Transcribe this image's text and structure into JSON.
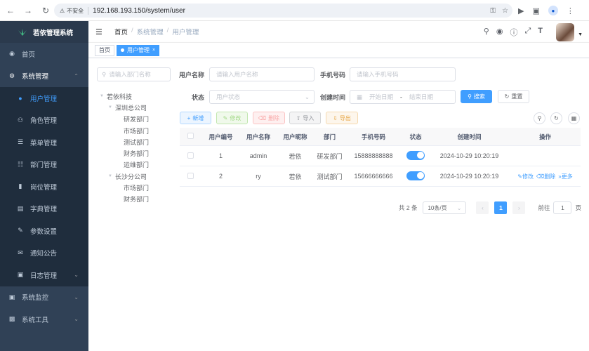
{
  "browser": {
    "security_label": "不安全",
    "url": "192.168.193.150/system/user"
  },
  "sidebar": {
    "logo_text": "若依管理系统",
    "items": [
      {
        "label": "首页",
        "icon": "dashboard-icon"
      },
      {
        "label": "系统管理",
        "icon": "gear-icon",
        "expanded": true
      },
      {
        "label": "系统监控",
        "icon": "monitor-icon"
      },
      {
        "label": "系统工具",
        "icon": "tool-icon"
      }
    ],
    "sub_items": [
      {
        "label": "用户管理",
        "active": true
      },
      {
        "label": "角色管理"
      },
      {
        "label": "菜单管理"
      },
      {
        "label": "部门管理"
      },
      {
        "label": "岗位管理"
      },
      {
        "label": "字典管理"
      },
      {
        "label": "参数设置"
      },
      {
        "label": "通知公告"
      },
      {
        "label": "日志管理"
      }
    ],
    "active_color": "#409eff",
    "background": "#304156"
  },
  "breadcrumb": [
    "首页",
    "系统管理",
    "用户管理"
  ],
  "tags": [
    {
      "label": "首页"
    },
    {
      "label": "用户管理",
      "active": true
    }
  ],
  "dept_search": {
    "placeholder": "请输入部门名称"
  },
  "dept_tree": [
    {
      "label": "若依科技",
      "level": 0,
      "caret": true
    },
    {
      "label": "深圳总公司",
      "level": 1,
      "caret": true
    },
    {
      "label": "研发部门",
      "level": 2
    },
    {
      "label": "市场部门",
      "level": 2
    },
    {
      "label": "测试部门",
      "level": 2
    },
    {
      "label": "财务部门",
      "level": 2
    },
    {
      "label": "运维部门",
      "level": 2
    },
    {
      "label": "长沙分公司",
      "level": 1,
      "caret": true
    },
    {
      "label": "市场部门",
      "level": 2
    },
    {
      "label": "财务部门",
      "level": 2
    }
  ],
  "search_form": {
    "username_label": "用户名称",
    "username_placeholder": "请输入用户名称",
    "phone_label": "手机号码",
    "phone_placeholder": "请输入手机号码",
    "status_label": "状态",
    "status_placeholder": "用户状态",
    "created_label": "创建时间",
    "start_placeholder": "开始日期",
    "range_sep": "-",
    "end_placeholder": "结束日期",
    "search_btn": "搜索",
    "reset_btn": "重置"
  },
  "toolbar": {
    "add": "新增",
    "edit": "修改",
    "delete": "删除",
    "import": "导入",
    "export": "导出"
  },
  "table": {
    "columns": [
      "用户编号",
      "用户名称",
      "用户昵称",
      "部门",
      "手机号码",
      "状态",
      "创建时间",
      "操作"
    ],
    "rows": [
      {
        "id": "1",
        "username": "admin",
        "nickname": "若依",
        "dept": "研发部门",
        "phone": "15888888888",
        "status_on": true,
        "created": "2024-10-29 10:20:19",
        "ops": []
      },
      {
        "id": "2",
        "username": "ry",
        "nickname": "若依",
        "dept": "测试部门",
        "phone": "15666666666",
        "status_on": true,
        "created": "2024-10-29 10:20:19",
        "ops": [
          "修改",
          "删除",
          "更多"
        ]
      }
    ]
  },
  "pagination": {
    "total_text": "共 2 条",
    "page_size": "10条/页",
    "current_page": "1",
    "goto_prefix": "前往",
    "goto_value": "1",
    "goto_suffix": "页"
  }
}
